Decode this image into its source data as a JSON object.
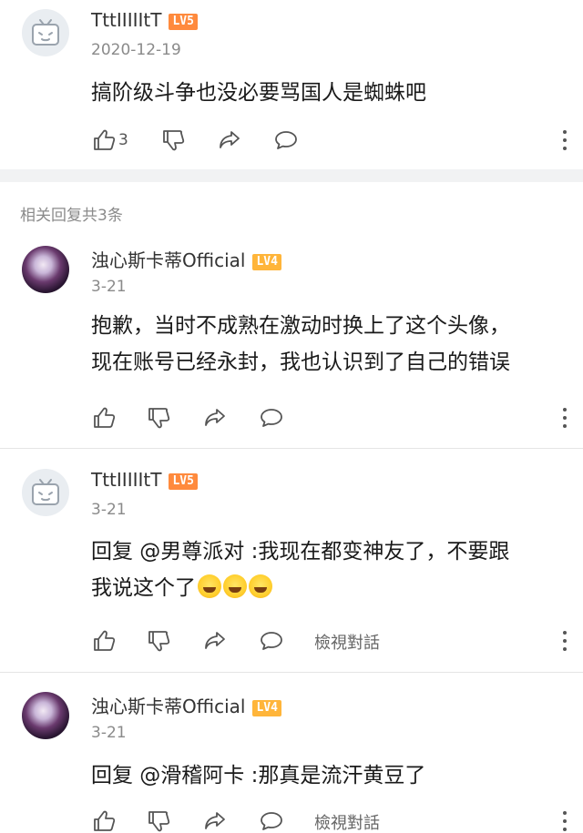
{
  "top_comment": {
    "username": "TttIIIIItT",
    "level": "LV5",
    "date": "2020-12-19",
    "text": "搞阶级斗争也没必要骂国人是蜘蛛吧",
    "like_count": "3"
  },
  "section_title": "相关回复共3条",
  "replies": [
    {
      "username": "浊心斯卡蒂Official",
      "level": "LV4",
      "date": "3-21",
      "text_line1": "抱歉，当时不成熟在激动时换上了这个头像，",
      "text_line2": "现在账号已经永封，我也认识到了自己的错误"
    },
    {
      "username": "TttIIIIItT",
      "level": "LV5",
      "date": "3-21",
      "text_line1": "回复 @男尊派对 :我现在都变神友了，不要跟",
      "text_line2": "我说这个了",
      "emojis": [
        "grin-sweat-emoji",
        "grin-sweat-emoji",
        "grin-sweat-emoji"
      ],
      "view_convo": "檢視對話"
    },
    {
      "username": "浊心斯卡蒂Official",
      "level": "LV4",
      "date": "3-21",
      "text_line1": "回复 @滑稽阿卡 :那真是流汗黄豆了",
      "view_convo": "檢視對話"
    }
  ],
  "icons": {
    "like": "thumb-up-icon",
    "dislike": "thumb-down-icon",
    "share": "share-icon",
    "reply": "comment-icon",
    "more": "more-vertical-icon"
  },
  "colors": {
    "lv5": "#ff8a3d",
    "lv4": "#ffb53a",
    "band": "#f1f2f3"
  }
}
